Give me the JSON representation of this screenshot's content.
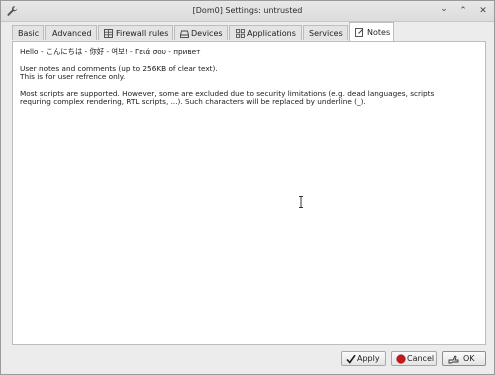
{
  "window": {
    "title": "[Dom0] Settings: untrusted",
    "controls": {
      "minimize": "⌄",
      "maximize": "⌃",
      "close": "✕"
    }
  },
  "tabs": [
    {
      "label": "Basic",
      "icon": null,
      "active": false
    },
    {
      "label": "Advanced",
      "icon": null,
      "active": false
    },
    {
      "label": "Firewall rules",
      "icon": "firewall-grid-icon",
      "active": false
    },
    {
      "label": "Devices",
      "icon": "device-drive-icon",
      "active": false
    },
    {
      "label": "Applications",
      "icon": "applications-grid-icon",
      "active": false
    },
    {
      "label": "Services",
      "icon": null,
      "active": false
    },
    {
      "label": "Notes",
      "icon": "notes-edit-icon",
      "active": true
    }
  ],
  "notes": {
    "line1": "Hello - こんにちは - 你好 - 여보! - Γειά σου - привет",
    "line2": "User notes and comments (up to 256KB of clear text).",
    "line3": "This is for user refrence only.",
    "line4": "Most scripts are supported. However, some are excluded due to security limitations (e.g. dead languages, scripts",
    "line5": "requring complex rendering, RTL scripts, ...). Such characters will be replaced by underline (_)."
  },
  "buttons": {
    "apply": "Apply",
    "cancel": "Cancel",
    "ok": "OK"
  },
  "colors": {
    "cancel_icon": "#c8161d",
    "apply_check": "#1a1a1a"
  }
}
